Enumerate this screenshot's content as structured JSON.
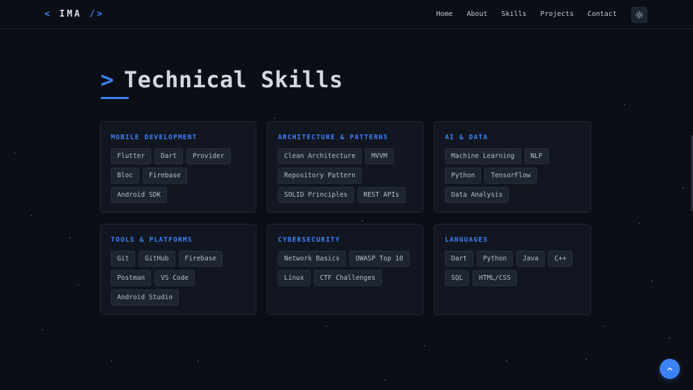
{
  "nav": {
    "logo_open": "<",
    "logo_name": "IMA",
    "logo_close": "/>",
    "links": [
      "Home",
      "About",
      "Skills",
      "Projects",
      "Contact"
    ],
    "theme_icon": "sun-icon"
  },
  "section": {
    "prompt": ">",
    "title": "Technical Skills"
  },
  "categories": [
    {
      "title": "MOBILE DEVELOPMENT",
      "tags": [
        "Flutter",
        "Dart",
        "Provider",
        "Bloc",
        "Firebase",
        "Android SDK"
      ]
    },
    {
      "title": "ARCHITECTURE & PATTERNS",
      "tags": [
        "Clean Architecture",
        "MVVM",
        "Repository Pattern",
        "SOLID Principles",
        "REST APIs"
      ]
    },
    {
      "title": "AI & DATA",
      "tags": [
        "Machine Learning",
        "NLP",
        "Python",
        "TensorFlow",
        "Data Analysis"
      ]
    },
    {
      "title": "TOOLS & PLATFORMS",
      "tags": [
        "Git",
        "GitHub",
        "Firebase",
        "Postman",
        "VS Code",
        "Android Studio"
      ]
    },
    {
      "title": "CYBERSECURITY",
      "tags": [
        "Network Basics",
        "OWASP Top 10",
        "Linux",
        "CTF Challenges"
      ]
    },
    {
      "title": "LANGUAGES",
      "tags": [
        "Dart",
        "Python",
        "Java",
        "C++",
        "SQL",
        "HTML/CSS"
      ]
    }
  ],
  "scroll_top_icon": "chevron-up-icon",
  "colors": {
    "accent": "#3b82f6",
    "background": "#0b0e14",
    "card": "#121620",
    "tag": "#1e2431"
  }
}
